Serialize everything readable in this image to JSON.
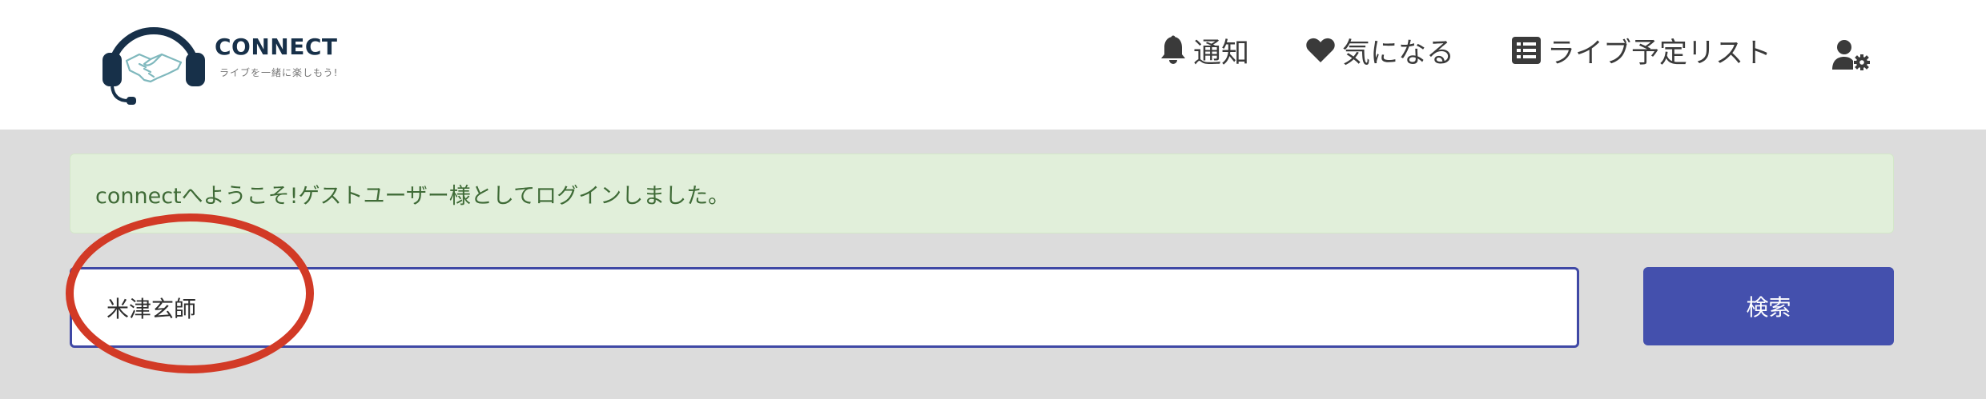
{
  "brand": {
    "title": "CONNECT",
    "tagline": "ライブを一緒に楽しもう!"
  },
  "nav": {
    "notifications_label": "通知",
    "favorites_label": "気になる",
    "live_list_label": "ライブ予定リスト"
  },
  "alert": {
    "message": "connectへようこそ!ゲストユーザー様としてログインしました。"
  },
  "search": {
    "value": "米津玄師",
    "button_label": "検索"
  },
  "colors": {
    "accent": "#4450ad",
    "alert_bg": "#e1efda",
    "alert_text": "#3f6b37",
    "annotation": "#d23a26",
    "logo_dark": "#173049"
  },
  "icons": [
    "headset-handshake-logo",
    "bell-icon",
    "heart-icon",
    "list-icon",
    "user-gear-icon"
  ]
}
